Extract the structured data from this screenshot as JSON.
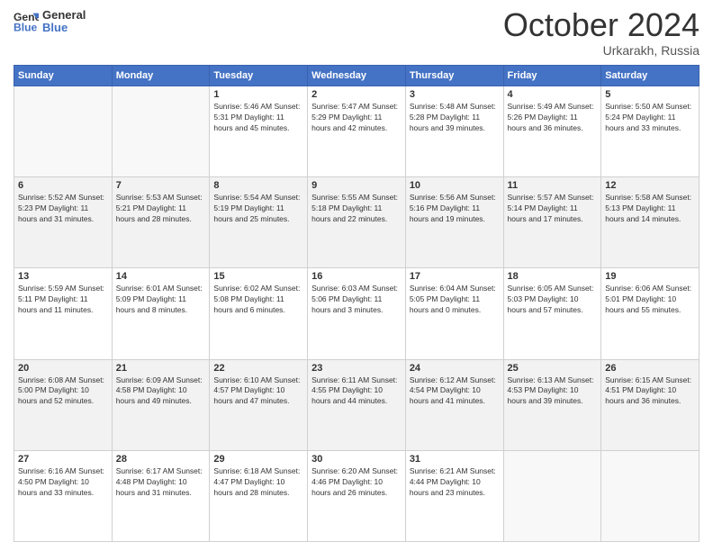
{
  "header": {
    "logo_line1": "General",
    "logo_line2": "Blue",
    "month": "October 2024",
    "location": "Urkarakh, Russia"
  },
  "days_of_week": [
    "Sunday",
    "Monday",
    "Tuesday",
    "Wednesday",
    "Thursday",
    "Friday",
    "Saturday"
  ],
  "weeks": [
    [
      {
        "day": "",
        "info": ""
      },
      {
        "day": "",
        "info": ""
      },
      {
        "day": "1",
        "info": "Sunrise: 5:46 AM\nSunset: 5:31 PM\nDaylight: 11 hours and 45 minutes."
      },
      {
        "day": "2",
        "info": "Sunrise: 5:47 AM\nSunset: 5:29 PM\nDaylight: 11 hours and 42 minutes."
      },
      {
        "day": "3",
        "info": "Sunrise: 5:48 AM\nSunset: 5:28 PM\nDaylight: 11 hours and 39 minutes."
      },
      {
        "day": "4",
        "info": "Sunrise: 5:49 AM\nSunset: 5:26 PM\nDaylight: 11 hours and 36 minutes."
      },
      {
        "day": "5",
        "info": "Sunrise: 5:50 AM\nSunset: 5:24 PM\nDaylight: 11 hours and 33 minutes."
      }
    ],
    [
      {
        "day": "6",
        "info": "Sunrise: 5:52 AM\nSunset: 5:23 PM\nDaylight: 11 hours and 31 minutes."
      },
      {
        "day": "7",
        "info": "Sunrise: 5:53 AM\nSunset: 5:21 PM\nDaylight: 11 hours and 28 minutes."
      },
      {
        "day": "8",
        "info": "Sunrise: 5:54 AM\nSunset: 5:19 PM\nDaylight: 11 hours and 25 minutes."
      },
      {
        "day": "9",
        "info": "Sunrise: 5:55 AM\nSunset: 5:18 PM\nDaylight: 11 hours and 22 minutes."
      },
      {
        "day": "10",
        "info": "Sunrise: 5:56 AM\nSunset: 5:16 PM\nDaylight: 11 hours and 19 minutes."
      },
      {
        "day": "11",
        "info": "Sunrise: 5:57 AM\nSunset: 5:14 PM\nDaylight: 11 hours and 17 minutes."
      },
      {
        "day": "12",
        "info": "Sunrise: 5:58 AM\nSunset: 5:13 PM\nDaylight: 11 hours and 14 minutes."
      }
    ],
    [
      {
        "day": "13",
        "info": "Sunrise: 5:59 AM\nSunset: 5:11 PM\nDaylight: 11 hours and 11 minutes."
      },
      {
        "day": "14",
        "info": "Sunrise: 6:01 AM\nSunset: 5:09 PM\nDaylight: 11 hours and 8 minutes."
      },
      {
        "day": "15",
        "info": "Sunrise: 6:02 AM\nSunset: 5:08 PM\nDaylight: 11 hours and 6 minutes."
      },
      {
        "day": "16",
        "info": "Sunrise: 6:03 AM\nSunset: 5:06 PM\nDaylight: 11 hours and 3 minutes."
      },
      {
        "day": "17",
        "info": "Sunrise: 6:04 AM\nSunset: 5:05 PM\nDaylight: 11 hours and 0 minutes."
      },
      {
        "day": "18",
        "info": "Sunrise: 6:05 AM\nSunset: 5:03 PM\nDaylight: 10 hours and 57 minutes."
      },
      {
        "day": "19",
        "info": "Sunrise: 6:06 AM\nSunset: 5:01 PM\nDaylight: 10 hours and 55 minutes."
      }
    ],
    [
      {
        "day": "20",
        "info": "Sunrise: 6:08 AM\nSunset: 5:00 PM\nDaylight: 10 hours and 52 minutes."
      },
      {
        "day": "21",
        "info": "Sunrise: 6:09 AM\nSunset: 4:58 PM\nDaylight: 10 hours and 49 minutes."
      },
      {
        "day": "22",
        "info": "Sunrise: 6:10 AM\nSunset: 4:57 PM\nDaylight: 10 hours and 47 minutes."
      },
      {
        "day": "23",
        "info": "Sunrise: 6:11 AM\nSunset: 4:55 PM\nDaylight: 10 hours and 44 minutes."
      },
      {
        "day": "24",
        "info": "Sunrise: 6:12 AM\nSunset: 4:54 PM\nDaylight: 10 hours and 41 minutes."
      },
      {
        "day": "25",
        "info": "Sunrise: 6:13 AM\nSunset: 4:53 PM\nDaylight: 10 hours and 39 minutes."
      },
      {
        "day": "26",
        "info": "Sunrise: 6:15 AM\nSunset: 4:51 PM\nDaylight: 10 hours and 36 minutes."
      }
    ],
    [
      {
        "day": "27",
        "info": "Sunrise: 6:16 AM\nSunset: 4:50 PM\nDaylight: 10 hours and 33 minutes."
      },
      {
        "day": "28",
        "info": "Sunrise: 6:17 AM\nSunset: 4:48 PM\nDaylight: 10 hours and 31 minutes."
      },
      {
        "day": "29",
        "info": "Sunrise: 6:18 AM\nSunset: 4:47 PM\nDaylight: 10 hours and 28 minutes."
      },
      {
        "day": "30",
        "info": "Sunrise: 6:20 AM\nSunset: 4:46 PM\nDaylight: 10 hours and 26 minutes."
      },
      {
        "day": "31",
        "info": "Sunrise: 6:21 AM\nSunset: 4:44 PM\nDaylight: 10 hours and 23 minutes."
      },
      {
        "day": "",
        "info": ""
      },
      {
        "day": "",
        "info": ""
      }
    ]
  ]
}
